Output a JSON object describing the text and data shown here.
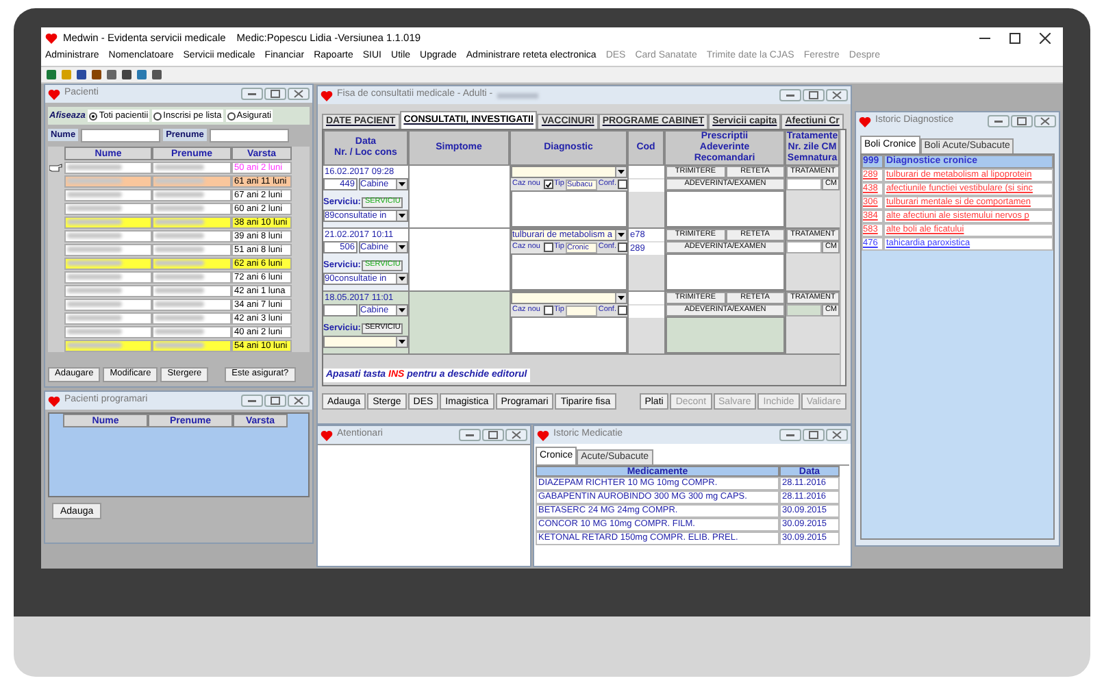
{
  "window": {
    "title": "Medwin - Evidenta servicii medicale",
    "subtitle": "Medic:Popescu Lidia -Versiunea 1.1.019"
  },
  "menu": [
    {
      "label": "Administrare",
      "disabled": false
    },
    {
      "label": "Nomenclatoare",
      "disabled": false
    },
    {
      "label": "Servicii medicale",
      "disabled": false
    },
    {
      "label": "Financiar",
      "disabled": false
    },
    {
      "label": "Rapoarte",
      "disabled": false
    },
    {
      "label": "SIUI",
      "disabled": false
    },
    {
      "label": "Utile",
      "disabled": false
    },
    {
      "label": "Upgrade",
      "disabled": false
    },
    {
      "label": "Administrare reteta electronica",
      "disabled": false
    },
    {
      "label": "DES",
      "disabled": true
    },
    {
      "label": "Card Sanatate",
      "disabled": true
    },
    {
      "label": "Trimite date la CJAS",
      "disabled": true
    },
    {
      "label": "Ferestre",
      "disabled": true
    },
    {
      "label": "Despre",
      "disabled": true
    }
  ],
  "patients_window": {
    "title": "Pacienti",
    "filter_label": "Afiseaza",
    "filters": [
      {
        "label": "Toti pacientii",
        "selected": true
      },
      {
        "label": "Inscrisi pe lista",
        "selected": false
      },
      {
        "label": "Asigurati",
        "selected": false
      }
    ],
    "search": [
      "Nume",
      "Prenume"
    ],
    "columns": [
      "Nume",
      "Prenume",
      "Varsta"
    ],
    "rows": [
      {
        "age": "50 ani 2 luni",
        "color": "#ffffff",
        "selected": true
      },
      {
        "age": "61 ani 11 luni",
        "color": "#f9c69c",
        "selected": false
      },
      {
        "age": "67 ani 2 luni",
        "color": "#ffffff",
        "selected": false
      },
      {
        "age": "60 ani 2 luni",
        "color": "#ffffff",
        "selected": false
      },
      {
        "age": "38 ani 10 luni",
        "color": "#ffff3c",
        "selected": false
      },
      {
        "age": "39 ani 8 luni",
        "color": "#ffffff",
        "selected": false
      },
      {
        "age": "51 ani 8 luni",
        "color": "#ffffff",
        "selected": false
      },
      {
        "age": "62 ani 6 luni",
        "color": "#ffff3c",
        "selected": false
      },
      {
        "age": "72 ani 6 luni",
        "color": "#ffffff",
        "selected": false
      },
      {
        "age": "42 ani 1 luna",
        "color": "#ffffff",
        "selected": false
      },
      {
        "age": "34 ani 7 luni",
        "color": "#ffffff",
        "selected": false
      },
      {
        "age": "42 ani 3 luni",
        "color": "#ffffff",
        "selected": false
      },
      {
        "age": "40 ani 2 luni",
        "color": "#ffffff",
        "selected": false
      },
      {
        "age": "54 ani 10 luni",
        "color": "#ffff3c",
        "selected": false
      }
    ],
    "buttons": [
      "Adaugare",
      "Modificare",
      "Stergere",
      "Este asigurat?"
    ]
  },
  "scheduled_window": {
    "title": "Pacienti programari",
    "columns": [
      "Nume",
      "Prenume",
      "Varsta"
    ],
    "button": "Adauga"
  },
  "consult_window": {
    "title": "Fisa de consultatii medicale - Adulti -",
    "tabs": [
      {
        "label": "DATE PACIENT",
        "selected": false
      },
      {
        "label": "CONSULTATII, INVESTIGATII",
        "selected": true
      },
      {
        "label": "VACCINURI",
        "selected": false
      },
      {
        "label": "PROGRAME CABINET",
        "selected": false
      },
      {
        "label": "Servicii capita",
        "selected": false
      },
      {
        "label": "Afectiuni Cr",
        "selected": false
      }
    ],
    "columns": [
      [
        "Data",
        "Nr. / Loc cons"
      ],
      [
        "Simptome"
      ],
      [
        "Diagnostic"
      ],
      [
        "Cod"
      ],
      [
        "Prescriptii",
        "Adeverinte",
        "Recomandari"
      ],
      [
        "Tratamente",
        "Nr. zile CM",
        "Semnatura"
      ]
    ],
    "entries": [
      {
        "date": "16.02.2017 09:28",
        "number": "449",
        "location": "Cabine",
        "service_label": "Serviciu:",
        "service_button": "SERVICIU",
        "service": "89consultatie in",
        "new_case_label": "Caz nou",
        "new_case": true,
        "type_label": "Tip",
        "type": "Subacu",
        "conf_label": "Conf.",
        "confirmed": false,
        "buttons": [
          "TRIMITERE",
          "RETETA",
          "TRATAMENT",
          "ADEVERINTA/EXAMEN",
          "CM"
        ],
        "selected": false
      },
      {
        "date": "21.02.2017 10:11",
        "number": "506",
        "location": "Cabine",
        "service_label": "Serviciu:",
        "service_button": "SERVICIU",
        "service": "90consultatie in",
        "diagnostic": "tulburari de metabolism a",
        "code": "e78",
        "new_case_label": "Caz nou",
        "new_case": false,
        "type_label": "Tip",
        "type": "Cronic",
        "conf_label": "Conf.",
        "confirmed": false,
        "code_2": "289",
        "buttons": [
          "TRIMITERE",
          "RETETA",
          "TRATAMENT",
          "ADEVERINTA/EXAMEN",
          "CM"
        ],
        "selected": false
      },
      {
        "date": "18.05.2017 11:01",
        "location": "Cabine",
        "service_label": "Serviciu:",
        "service_button": "SERVICIU",
        "new_case_label": "Caz nou",
        "new_case": false,
        "type_label": "Tip",
        "conf_label": "Conf.",
        "confirmed": false,
        "buttons": [
          "TRIMITERE",
          "RETETA",
          "TRATAMENT",
          "ADEVERINTA/EXAMEN",
          "CM"
        ],
        "selected": true
      }
    ],
    "hint": {
      "before": "Apasati tasta",
      "key": "INS",
      "after": "pentru a deschide editorul"
    },
    "buttons": [
      {
        "label": "Adauga",
        "disabled": false
      },
      {
        "label": "Sterge",
        "disabled": false
      },
      {
        "label": "DES",
        "disabled": false
      },
      {
        "label": "Imagistica",
        "disabled": false
      },
      {
        "label": "Programari",
        "disabled": false
      },
      {
        "label": "Tiparire fisa",
        "disabled": false
      }
    ],
    "right_buttons": [
      {
        "label": "Plati",
        "disabled": false
      },
      {
        "label": "Decont",
        "disabled": true
      },
      {
        "label": "Salvare",
        "disabled": true
      },
      {
        "label": "Inchide",
        "disabled": true
      },
      {
        "label": "Validare",
        "disabled": true
      }
    ]
  },
  "alerts_window": {
    "title": "Atentionari"
  },
  "medication_window": {
    "title": "Istoric Medicatie",
    "tabs": [
      {
        "label": "Cronice",
        "selected": true
      },
      {
        "label": "Acute/Subacute",
        "selected": false
      }
    ],
    "columns": [
      "Medicamente",
      "Data"
    ],
    "rows": [
      {
        "name": "DIAZEPAM RICHTER 10 MG 10mg COMPR.",
        "date": "28.11.2016"
      },
      {
        "name": "GABAPENTIN AUROBINDO 300 MG 300 mg CAPS.",
        "date": "28.11.2016"
      },
      {
        "name": "BETASERC 24 MG 24mg COMPR.",
        "date": "30.09.2015"
      },
      {
        "name": "CONCOR  10 MG 10mg COMPR. FILM.",
        "date": "30.09.2015"
      },
      {
        "name": "KETONAL RETARD 150mg COMPR. ELIB. PREL.",
        "date": "30.09.2015"
      }
    ]
  },
  "diagnostics_window": {
    "title": "Istoric Diagnostice",
    "tabs": [
      {
        "label": "Boli Cronice",
        "selected": true
      },
      {
        "label": "Boli Acute/Subacute",
        "selected": false
      }
    ],
    "header": {
      "code": "999",
      "label": "Diagnostice cronice"
    },
    "rows": [
      {
        "code": "289",
        "label": "tulburari de metabolism al lipoprotein",
        "color": "#ff3b3b"
      },
      {
        "code": "438",
        "label": "afectiunile functiei vestibulare (si sinc",
        "color": "#ff3b3b"
      },
      {
        "code": "306",
        "label": "tulburari mentale si de comportamen",
        "color": "#ff3b3b"
      },
      {
        "code": "384",
        "label": "alte afectiuni ale sistemului nervos p",
        "color": "#ff3b3b"
      },
      {
        "code": "583",
        "label": "alte boli ale ficatului",
        "color": "#ff3b3b"
      },
      {
        "code": "476",
        "label": "tahicardia paroxistica",
        "color": "#3b3bff"
      }
    ]
  }
}
